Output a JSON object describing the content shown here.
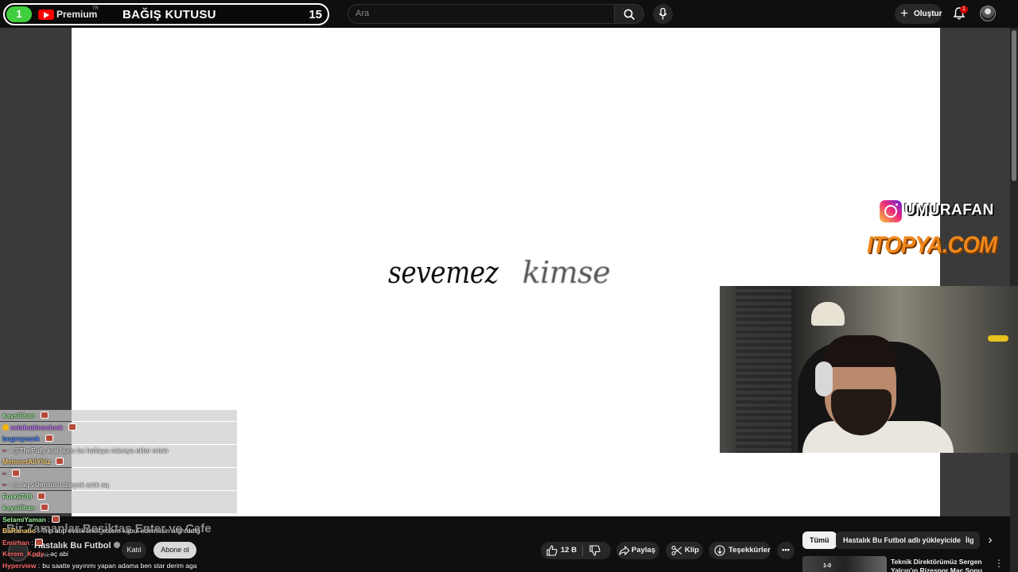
{
  "donation_bar": {
    "count": "1",
    "brand": "Premium",
    "brand_region": "TR",
    "title": "BAĞIŞ KUTUSU",
    "total": "15"
  },
  "header": {
    "search_placeholder": "Ara",
    "create_label": "Oluştur",
    "notifications_count": "1"
  },
  "video": {
    "lyric_word_1": "sevemez",
    "lyric_word_2": "kimse",
    "instagram_handle": "UMURAFAN",
    "sponsor": "ITOPYA.COM"
  },
  "chat": [
    {
      "user": "kaysiilhan",
      "sep": " :",
      "message": "",
      "emote": true,
      "user_color": "#9cf09c",
      "row_style": "light"
    },
    {
      "user": "selahattinselcuk",
      "sep": " :",
      "message": "",
      "emote": true,
      "badge": true,
      "user_color": "#c77dff",
      "row_style": "light"
    },
    {
      "user": "bugrayezek",
      "sep": " :",
      "message": "",
      "emote": true,
      "user_color": "#4d8cff",
      "row_style": "light"
    },
    {
      "user": "~",
      "sep": " :",
      "message": "@ThePally kral bunu bu haftaya videoya ekler misin",
      "emote": false,
      "user_color": "#d94040",
      "row_style": "light"
    },
    {
      "user": "MehmetAliYldz",
      "sep": " :",
      "message": "",
      "emote": true,
      "user_color": "#ffd27a",
      "row_style": "light"
    },
    {
      "user": "~",
      "sep": " :",
      "message": "",
      "emote": true,
      "user_color": "#d94040",
      "row_style": "light"
    },
    {
      "user": "~",
      "sep": " :",
      "message": "şu aq videosunu izleyek artık aq",
      "emote": false,
      "user_color": "#d94040",
      "row_style": "light"
    },
    {
      "user": "Furkii709",
      "sep": " :",
      "message": "",
      "emote": true,
      "user_color": "#9cf09c",
      "row_style": "light"
    },
    {
      "user": "kaysiilhan",
      "sep": " :",
      "message": "",
      "emote": true,
      "user_color": "#9cf09c",
      "row_style": "light"
    },
    {
      "user": "SelamiYaman",
      "sep": " :",
      "message": "",
      "emote": true,
      "user_color": "#9cf09c",
      "row_style": "dark"
    },
    {
      "user": "BaRanatic",
      "sep": " :",
      "message": "Trip atıp evlilik teklif etsem kabul edermisin afghfddfg",
      "emote": false,
      "user_color": "#ffd27a",
      "row_style": "dark"
    },
    {
      "user": "Emirhan",
      "sep": " :",
      "message": "",
      "emote": true,
      "user_color": "#ff6b6b",
      "row_style": "dark"
    },
    {
      "user": "Kerem_Kpdy",
      "sep": " :",
      "message": "aç abi",
      "emote": false,
      "user_color": "#ff6b6b",
      "row_style": "dark"
    },
    {
      "user": "Hyperview",
      "sep": " :",
      "message": "bu saatte yayınmı yapan adama ben star derim aga",
      "emote": false,
      "user_color": "#ff6b6b",
      "row_style": "dark"
    }
  ],
  "watch": {
    "title": "Bir Zamanlar Beşiktaş Enter ve Cafe",
    "channel": "Hastalık Bu Futbol",
    "subscribers": "abone",
    "join_label": "Katıl",
    "subscribe_label": "Abone ol",
    "likes": "12 B",
    "share_label": "Paylaş",
    "clip_label": "Klip",
    "thanks_label": "Teşekkürler",
    "more_label": "•••"
  },
  "chips": [
    {
      "label": "Tümü",
      "active": true
    },
    {
      "label": "Hastalık Bu Futbol adlı yükleyiciden",
      "active": false
    },
    {
      "label": "İlg",
      "active": false
    }
  ],
  "recommendation": {
    "title": "Teknik Direktörümüz Sergen Yalçın'ın Rizespor Maç Sonu",
    "score": "1-0"
  },
  "colors": {
    "donation_green": "#3fcf3f",
    "youtube_red": "#ff0000",
    "sponsor_orange": "#f0871c",
    "chat_row_bg": "#cdcdcd"
  }
}
